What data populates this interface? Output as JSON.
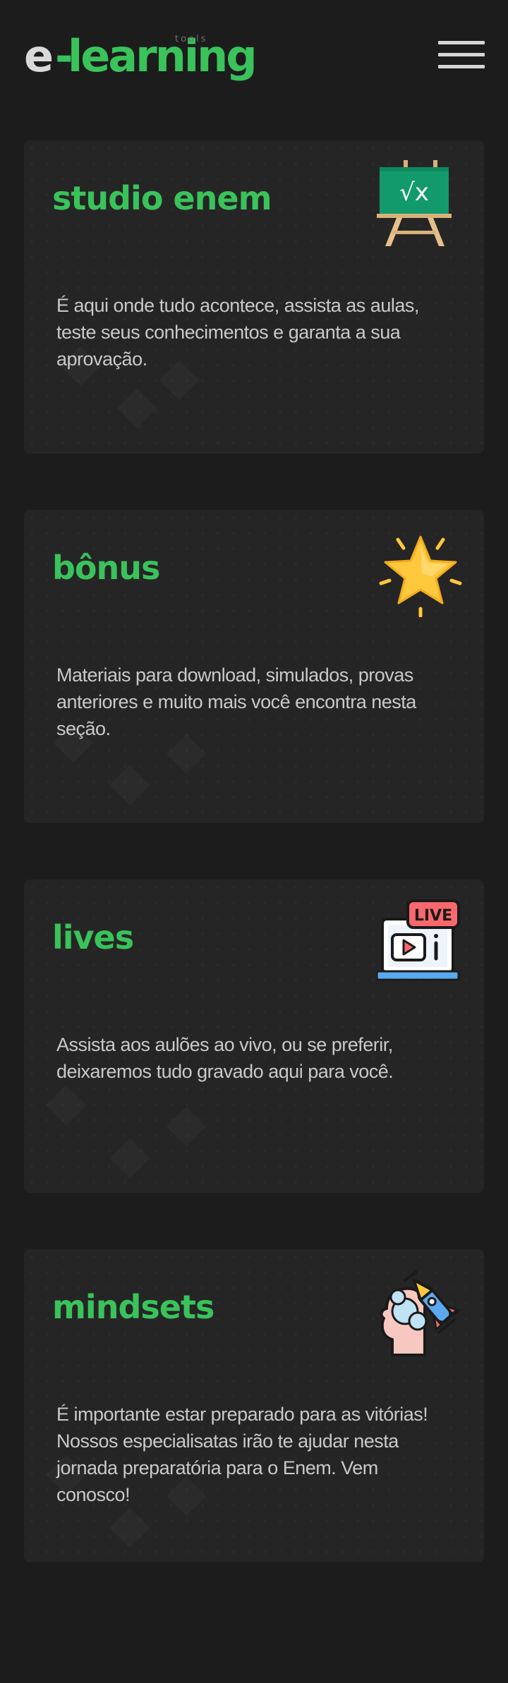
{
  "header": {
    "logo_e": "e",
    "logo_dash": "-",
    "logo_word": "learning",
    "logo_tools": "tools",
    "menu_icon": "hamburger-menu-icon"
  },
  "colors": {
    "background": "#1c1c1d",
    "card": "#262526",
    "accent": "#39c35a",
    "text": "#c9c9c9"
  },
  "cards": [
    {
      "title": "studio enem",
      "description": "É aqui onde tudo acontece, assista as aulas, teste seus conhecimentos e garanta a sua aprovação.",
      "icon": "chalkboard-sqrt-icon"
    },
    {
      "title": "bônus",
      "description": "Materiais para download, simulados, provas anteriores e muito mais você encontra nesta seção.",
      "icon": "star-icon"
    },
    {
      "title": "lives",
      "description": "Assista  aos aulões ao vivo, ou se preferir, deixaremos tudo gravado aqui para você.",
      "icon": "live-laptop-icon",
      "icon_badge": "LIVE"
    },
    {
      "title": "mindsets",
      "description": "É importante estar preparado para as vitórias! Nossos especialisatas irão te ajudar nesta jornada preparatória para o Enem. Vem conosco!",
      "icon": "head-rocket-icon"
    }
  ]
}
